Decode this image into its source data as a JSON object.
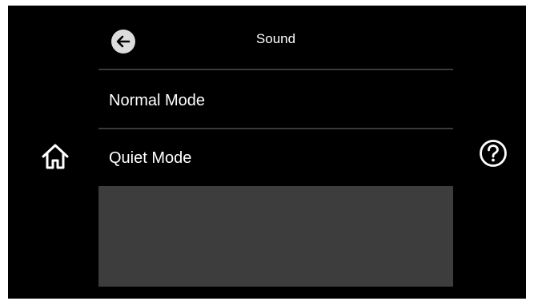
{
  "header": {
    "title": "Sound",
    "back_icon": "arrow-left-icon"
  },
  "menu": {
    "items": [
      {
        "label": "Normal Mode"
      },
      {
        "label": "Quiet Mode"
      }
    ]
  },
  "side": {
    "home_icon": "home-icon",
    "help_icon": "question-mark-icon"
  },
  "colors": {
    "background": "#000000",
    "text": "#ffffff",
    "divider": "#3a3a3a",
    "panel": "#3d3d3d",
    "back_button": "#dcdcdc"
  }
}
